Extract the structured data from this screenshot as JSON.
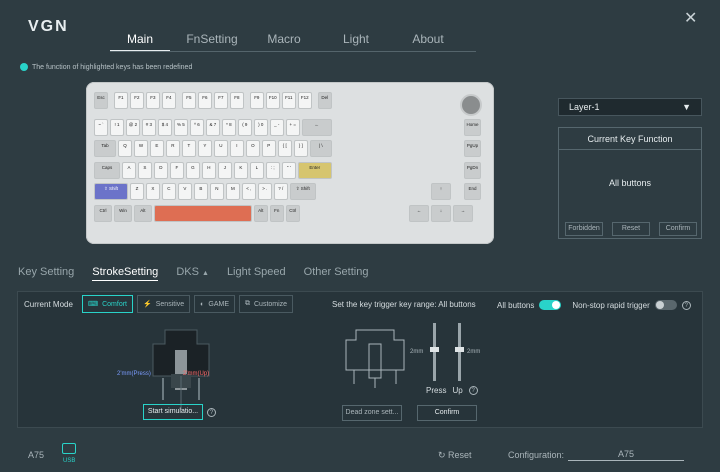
{
  "brand": "VGN",
  "tabs": [
    "Main",
    "FnSetting",
    "Macro",
    "Light",
    "About"
  ],
  "notice": "The function of highlighted keys has been redefined",
  "layer": "Layer-1",
  "ckf": {
    "title": "Current Key Function",
    "value": "All buttons",
    "buttons": [
      "Forbidden",
      "Reset",
      "Confirm"
    ]
  },
  "subtabs": [
    "Key Setting",
    "StrokeSetting",
    "DKS",
    "Light Speed",
    "Other Setting"
  ],
  "current_mode_label": "Current Mode",
  "modes": [
    "Comfort",
    "Sensitive",
    "GAME",
    "Customize"
  ],
  "range_label": "Set the key trigger key range: All buttons",
  "all_buttons": "All buttons",
  "nonstop": "Non-stop rapid trigger",
  "press_label": "2'mm(Press)",
  "up_label": "2'mm(Up)",
  "start_sim": "Start simulatio...",
  "dead_zone": "Dead zone sett...",
  "confirm": "Confirm",
  "mm_left": "2mm",
  "mm_right": "2mm",
  "press": "Press",
  "up": "Up",
  "footer": {
    "model": "A75",
    "usb": "USB",
    "reset": "Reset",
    "config_label": "Configuration:",
    "config_value": "A75"
  },
  "colors": {
    "accent": "#29d3c9",
    "bg": "#2e3c42"
  }
}
